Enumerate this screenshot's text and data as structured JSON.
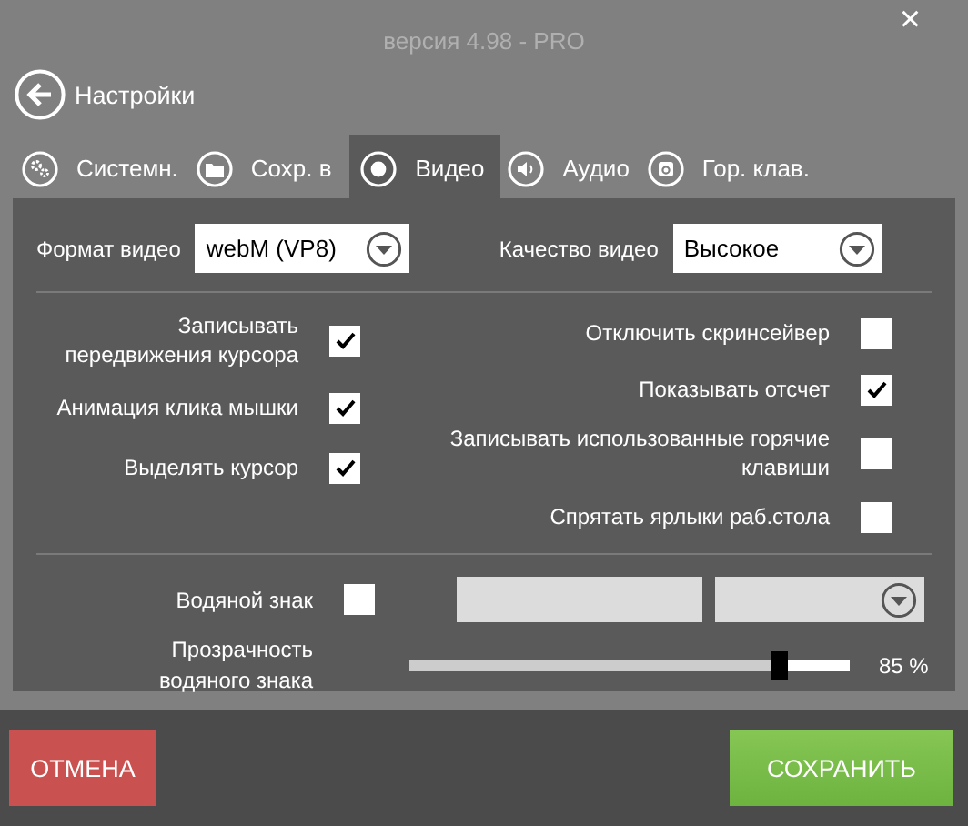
{
  "window": {
    "version": "версия 4.98 - PRO",
    "close": "×"
  },
  "header": {
    "title": "Настройки"
  },
  "tabs": [
    {
      "label": "Системн.",
      "kind": "gears",
      "selected": false
    },
    {
      "label": "Сохр. в",
      "kind": "folder",
      "selected": false
    },
    {
      "label": "Видео",
      "kind": "record",
      "selected": true
    },
    {
      "label": "Аудио",
      "kind": "speaker",
      "selected": false
    },
    {
      "label": "Гор. клав.",
      "kind": "key",
      "selected": false
    }
  ],
  "format": {
    "label": "Формат видео",
    "value": "webM (VP8)"
  },
  "quality": {
    "label": "Качество видео",
    "value": "Высокое"
  },
  "options_left": [
    {
      "label": "Записывать передвижения курсора",
      "checked": true
    },
    {
      "label": "Анимация клика мышки",
      "checked": true
    },
    {
      "label": "Выделять курсор",
      "checked": true
    }
  ],
  "options_right": [
    {
      "label": "Отключить скринсейвер",
      "checked": false
    },
    {
      "label": "Показывать отсчет",
      "checked": true
    },
    {
      "label": "Записывать использованные горячие клавиши",
      "checked": false
    },
    {
      "label": "Спрятать ярлыки раб.стола",
      "checked": false
    }
  ],
  "watermark": {
    "label": "Водяной знак",
    "checked": false
  },
  "opacity": {
    "label": "Прозрачность водяного знака",
    "level": 0.84,
    "reading": "85 %"
  },
  "buttons": {
    "cancel": "ОТМЕНА",
    "save": "СОХРАНИТЬ"
  }
}
